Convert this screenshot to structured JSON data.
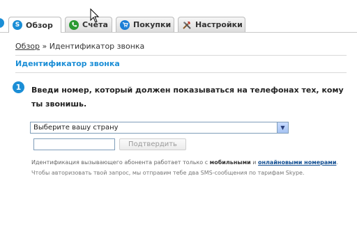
{
  "tabs": [
    {
      "label": "Обзор",
      "icon": "skype-icon",
      "active": true
    },
    {
      "label": "Счета",
      "icon": "phone-icon",
      "active": false
    },
    {
      "label": "Покупки",
      "icon": "cart-icon",
      "active": false
    },
    {
      "label": "Настройки",
      "icon": "tools-icon",
      "active": false
    }
  ],
  "breadcrumb": {
    "link": "Обзор",
    "separator": " » ",
    "current": "Идентификатор звонка"
  },
  "section": {
    "title": "Идентификатор звонка"
  },
  "step": {
    "number": "1",
    "instruction": "Введи номер, который должен показываться на телефонах тех, кому ты звонишь."
  },
  "form": {
    "country_select_value": "Выберите вашу страну",
    "phone_input_value": "",
    "confirm_label": "Подтвердить"
  },
  "notes": {
    "line1_part1": "Идентификация вызывающего абонента работает только с ",
    "line1_bold": "мобильными",
    "line1_part2": " и ",
    "line1_link": "онлайновыми номерами",
    "line1_end": ".",
    "line2": "Чтобы авторизовать твой запрос, мы отправим тебе два SMS-сообщения по тарифам Skype."
  },
  "colors": {
    "accent": "#1b8ed6",
    "link": "#0f4c91"
  }
}
